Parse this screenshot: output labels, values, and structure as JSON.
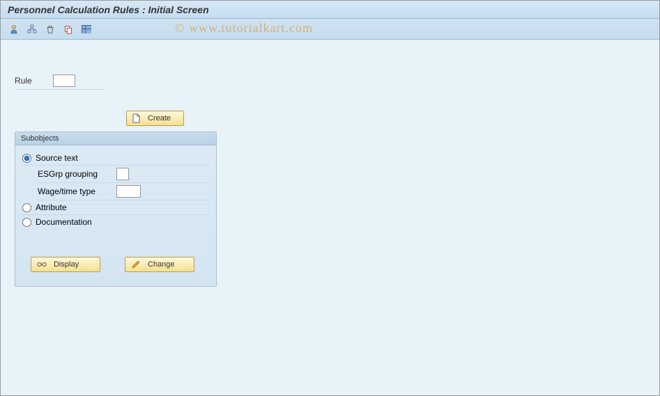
{
  "header": {
    "title": "Personnel Calculation Rules : Initial Screen"
  },
  "watermark": "© www.tutorialkart.com",
  "form": {
    "rule_label": "Rule",
    "rule_value": ""
  },
  "buttons": {
    "create_label": "Create",
    "display_label": "Display",
    "change_label": "Change"
  },
  "subobjects": {
    "heading": "Subobjects",
    "options": {
      "source_text": {
        "label": "Source text",
        "selected": true,
        "fields": {
          "esgrp_label": "ESGrp grouping",
          "esgrp_value": "",
          "wagetime_label": "Wage/time type",
          "wagetime_value": ""
        }
      },
      "attribute": {
        "label": "Attribute",
        "selected": false
      },
      "documentation": {
        "label": "Documentation",
        "selected": false
      }
    }
  }
}
